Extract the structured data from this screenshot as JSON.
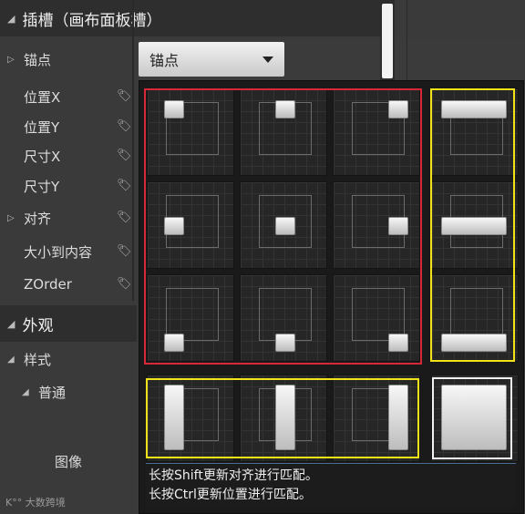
{
  "sections": {
    "slot_title": "插槽（画布面板槽）",
    "appearance_title": "外观"
  },
  "properties": {
    "anchor": "锚点",
    "pos_x": "位置X",
    "pos_y": "位置Y",
    "size_x": "尺寸X",
    "size_y": "尺寸Y",
    "alignment": "对齐",
    "size_to_content": "大小到内容",
    "zorder": "ZOrder",
    "style": "样式",
    "normal": "普通",
    "image": "图像"
  },
  "dropdown": {
    "value": "锚点"
  },
  "hint": {
    "line1": "长按Shift更新对齐进行匹配。",
    "line2": "长按Ctrl更新位置进行匹配。"
  },
  "watermark": "大数跨境",
  "colors": {
    "red_highlight": "#d7283a",
    "yellow_highlight": "#f2e318",
    "white_highlight": "#f2f2f2"
  },
  "icons": {
    "pin": "pin-icon",
    "expand": "triangle-right-icon",
    "collapse": "triangle-down-icon",
    "caret": "chevron-down-icon"
  }
}
